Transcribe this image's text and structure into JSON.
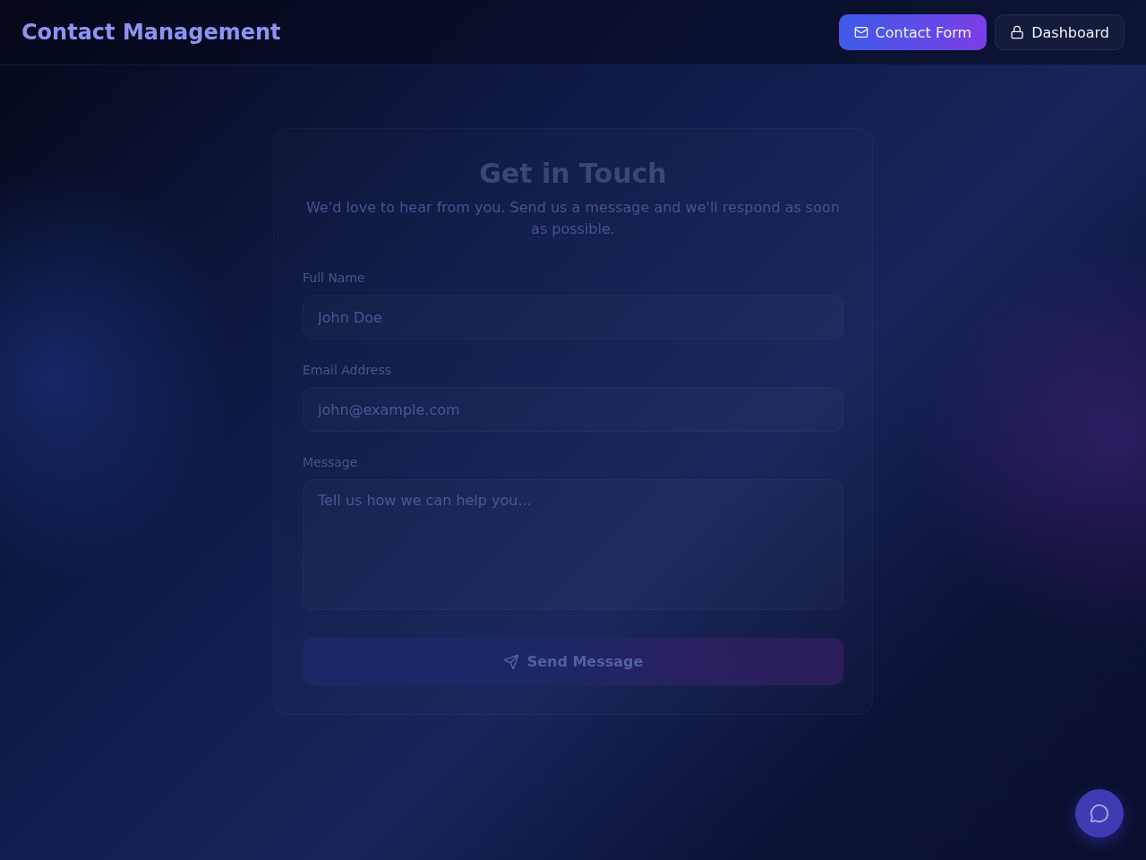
{
  "header": {
    "title": "Contact Management",
    "nav": [
      {
        "label": "Contact Form",
        "selected": true
      },
      {
        "label": "Dashboard",
        "selected": false
      }
    ]
  },
  "form": {
    "title": "Get in Touch",
    "subtitle": "We'd love to hear from you. Send us a message and we'll respond as soon as possible.",
    "fields": [
      {
        "kind": "input",
        "label": "Full Name",
        "placeholder": "John Doe"
      },
      {
        "kind": "input",
        "label": "Email Address",
        "placeholder": "john@example.com"
      },
      {
        "kind": "textarea",
        "label": "Message",
        "placeholder": "Tell us how we can help you..."
      }
    ],
    "submit": "Send Message"
  }
}
